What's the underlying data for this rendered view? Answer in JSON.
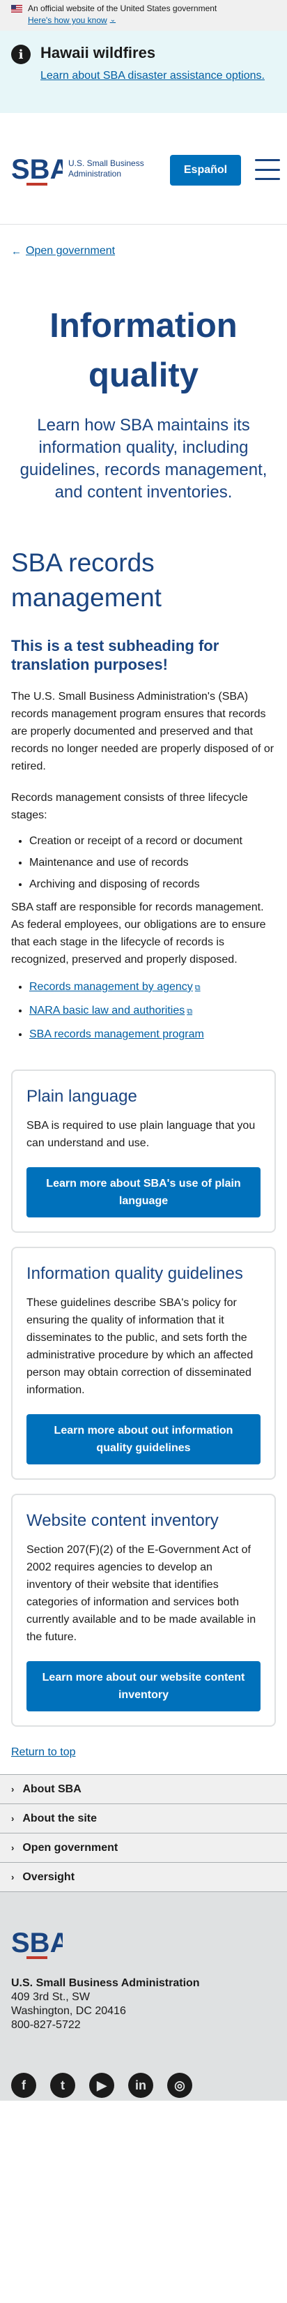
{
  "gov_banner": {
    "text": "An official website of the United States government",
    "link": "Here's how you know"
  },
  "alert": {
    "title": "Hawaii wildfires",
    "link": "Learn about SBA disaster assistance options."
  },
  "header": {
    "logo_line1": "U.S. Small Business",
    "logo_line2": "Administration",
    "espanol_label": "Español"
  },
  "breadcrumb": {
    "label": "Open government"
  },
  "hero": {
    "title": "Information quality",
    "lead": "Learn how SBA maintains its information quality, including guidelines, records management, and content inventories."
  },
  "records": {
    "heading": "SBA records management",
    "subheading": "This is a test subheading for translation purposes!",
    "p1": "The U.S. Small Business Administration's (SBA) records management program ensures that records are properly documented and preserved and that records no longer needed are properly disposed of or retired.",
    "p2": "Records management consists of three lifecycle stages:",
    "stages": [
      "Creation or receipt of a record or document",
      "Maintenance and use of records",
      "Archiving and disposing of records"
    ],
    "p3": "SBA staff are responsible for records management. As federal employees, our obligations are to ensure that each stage in the lifecycle of records is recognized, preserved and properly disposed.",
    "links": [
      "Records management by agency",
      "NARA basic law and authorities",
      "SBA records management program"
    ]
  },
  "cards": [
    {
      "title": "Plain language",
      "body": "SBA is required to use plain language that you can understand and use.",
      "button": "Learn more about SBA's use of plain language"
    },
    {
      "title": "Information quality guidelines",
      "body": "These guidelines describe SBA's policy for ensuring the quality of information that it disseminates to the public, and sets forth the administrative procedure by which an affected person may obtain correction of disseminated information.",
      "button": "Learn more about out information quality guidelines"
    },
    {
      "title": "Website content inventory",
      "body": "Section 207(F)(2) of the E-Government Act of 2002 requires agencies to develop an inventory of their website that identifies categories of information and services both currently available and to be made available in the future.",
      "button": "Learn more about our website content inventory"
    }
  ],
  "return_top": "Return to top",
  "accordion": [
    "About SBA",
    "About the site",
    "Open government",
    "Oversight"
  ],
  "footer": {
    "name": "U.S. Small Business Administration",
    "addr1": "409 3rd St., SW",
    "addr2": "Washington, DC 20416",
    "phone": "800-827-5722",
    "social_icons": [
      "facebook-icon",
      "twitter-icon",
      "youtube-icon",
      "linkedin-icon",
      "instagram-icon"
    ]
  }
}
